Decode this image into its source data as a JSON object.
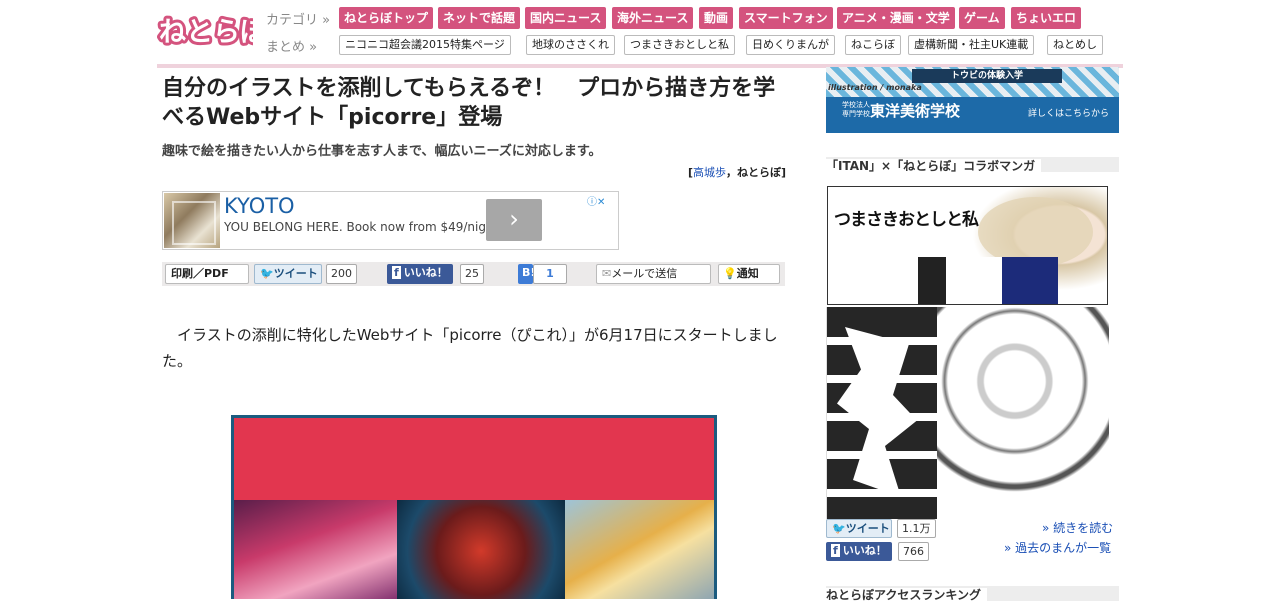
{
  "header": {
    "logo_text": "ねとらぼ",
    "category_label": "カテゴリ »",
    "matome_label": "まとめ »",
    "categories": [
      "ねとらぼトップ",
      "ネットで話題",
      "国内ニュース",
      "海外ニュース",
      "動画",
      "スマートフォン",
      "アニメ・漫画・文学",
      "ゲーム",
      "ちょいエロ"
    ],
    "matome": [
      "ニコニコ超会議2015特集ページ",
      "地球のささくれ",
      "つまさきおとしと私",
      "日めくりまんが",
      "ねこらぼ",
      "虚構新聞・社主UK連載",
      "ねとめし"
    ]
  },
  "article": {
    "title": "自分のイラストを添削してもらえるぞ！　プロから描き方を学べるWebサイト「picorre」登場",
    "subtitle": "趣味で絵を描きたい人から仕事を志す人まで、幅広いニーズに対応します。",
    "byline_open": "[",
    "byline_author": "高城歩",
    "byline_site": "，ねとらぼ]",
    "body": "イラストの添削に特化したWebサイト「picorre（ぴこれ）」が6月17日にスタートしました。"
  },
  "ad": {
    "headline": "KYOTO",
    "text": "YOU BELONG HERE. Book now from $49/night.",
    "arrow": "›",
    "info_icon": "ⓘ✕"
  },
  "share": {
    "print": "印刷／PDF",
    "tweet": "ツイート",
    "tweet_count": "200",
    "like": "いいね！",
    "like_count": "25",
    "hatena": "B!",
    "hatena_count": "1",
    "mail": "メールで送信",
    "notify": "通知"
  },
  "sidebar": {
    "banner": {
      "tag": "トウビの体験入学",
      "illus": "illustration / monaka",
      "small": "学校法人\n専門学校",
      "school": "東洋美術学校",
      "more": "詳しくはこちらから"
    },
    "collab_heading": "「ITAN」×「ねとらぼ」コラボマンガ",
    "manga_title": "つまさきおとしと私",
    "tweet": "ツイート",
    "tweet_count": "1.1万",
    "like": "いいね！",
    "like_count": "766",
    "read_more": "» 続きを読む",
    "past_list": "» 過去のまんが一覧",
    "ranking_heading": "ねとらぼアクセスランキング"
  },
  "colors": {
    "brand_pink": "#d4537e",
    "link_blue": "#1a4fb5",
    "facebook": "#3b5998",
    "hero_red": "#e2364f"
  }
}
